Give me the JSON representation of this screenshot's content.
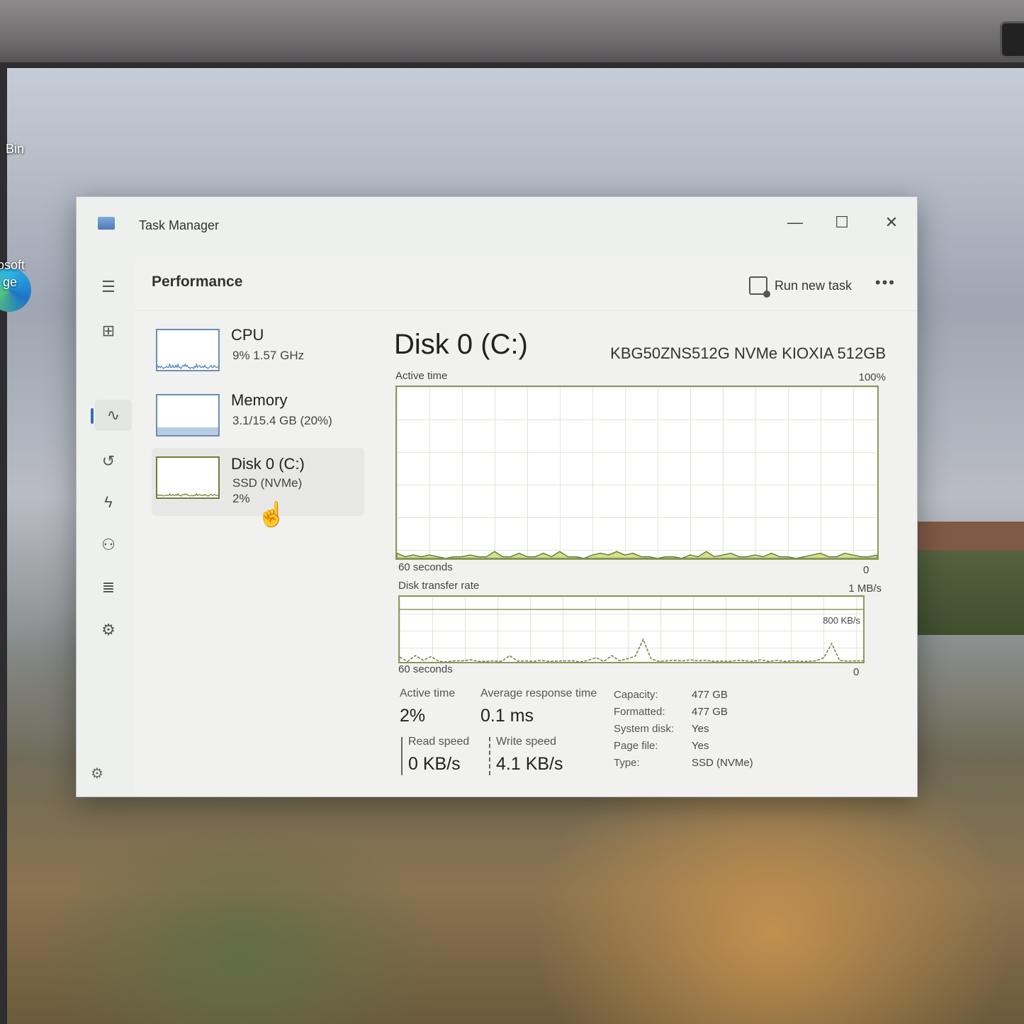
{
  "desktop": {
    "icons": [
      {
        "label": "Bin",
        "name": "recycle-bin-icon"
      },
      {
        "label": "osoft",
        "name": "edge-icon-label-line1"
      },
      {
        "label": "ge",
        "name": "edge-icon-label-line2"
      }
    ]
  },
  "window": {
    "title": "Task Manager",
    "controls": {
      "minimize": "—",
      "maximize": "☐",
      "close": "✕"
    }
  },
  "nav": [
    {
      "icon": "menu-icon",
      "glyph": "☰"
    },
    {
      "icon": "processes-icon",
      "glyph": "⊞"
    },
    {
      "icon": "performance-icon",
      "glyph": "∿",
      "active": true
    },
    {
      "icon": "app-history-icon",
      "glyph": "↺"
    },
    {
      "icon": "startup-apps-icon",
      "glyph": "ϟ"
    },
    {
      "icon": "users-icon",
      "glyph": "⚇"
    },
    {
      "icon": "details-icon",
      "glyph": "≣"
    },
    {
      "icon": "services-icon",
      "glyph": "⚙"
    }
  ],
  "header": {
    "title": "Performance",
    "run_task": "Run new task",
    "more": "•••"
  },
  "devices": [
    {
      "name": "CPU",
      "sub": "9%  1.57 GHz",
      "sub2": "",
      "usage": 0.09
    },
    {
      "name": "Memory",
      "sub": "3.1/15.4 GB (20%)",
      "sub2": "",
      "usage": 0.2
    },
    {
      "name": "Disk 0 (C:)",
      "sub": "SSD (NVMe)",
      "sub2": "2%",
      "usage": 0.02
    }
  ],
  "detail": {
    "title": "Disk 0 (C:)",
    "model": "KBG50ZNS512G NVMe KIOXIA 512GB",
    "active_chart": {
      "label": "Active time",
      "max_label": "100%",
      "x_label": "60 seconds",
      "min_label": "0"
    },
    "transfer_chart": {
      "label": "Disk transfer rate",
      "max_label": "1 MB/s",
      "mid_label": "800 KB/s",
      "x_label": "60 seconds",
      "min_label": "0"
    },
    "stats": {
      "active_label": "Active time",
      "active_value": "2%",
      "resp_label": "Average response time",
      "resp_value": "0.1 ms",
      "read_label": "Read speed",
      "read_value": "0 KB/s",
      "write_label": "Write speed",
      "write_value": "4.1 KB/s"
    },
    "properties": [
      {
        "k": "Capacity:",
        "v": "477 GB"
      },
      {
        "k": "Formatted:",
        "v": "477 GB"
      },
      {
        "k": "System disk:",
        "v": "Yes"
      },
      {
        "k": "Page file:",
        "v": "Yes"
      },
      {
        "k": "Type:",
        "v": "SSD (NVMe)"
      }
    ]
  },
  "chart_data": [
    {
      "type": "area",
      "title": "Active time",
      "ylabel": "",
      "ylim": [
        0,
        100
      ],
      "xlim": [
        60,
        0
      ],
      "x_unit": "seconds ago",
      "values": [
        3,
        1,
        2,
        1,
        2,
        1,
        0,
        1,
        1,
        2,
        1,
        1,
        4,
        1,
        1,
        3,
        1,
        1,
        3,
        1,
        4,
        1,
        1,
        0,
        2,
        3,
        2,
        4,
        2,
        3,
        1,
        1,
        0,
        1,
        1,
        0,
        2,
        1,
        4,
        1,
        2,
        3,
        1,
        1,
        2,
        1,
        3,
        1,
        1,
        0,
        1,
        2,
        3,
        1,
        1,
        3,
        2,
        1,
        1,
        2
      ]
    },
    {
      "type": "line",
      "title": "Disk transfer rate",
      "ylim": [
        0,
        1000
      ],
      "y_unit": "KB/s",
      "xlim": [
        60,
        0
      ],
      "series": [
        {
          "values": [
            90,
            10,
            120,
            30,
            100,
            10,
            0,
            20,
            20,
            40,
            10,
            10,
            20,
            10,
            120,
            15,
            20,
            10,
            30,
            10,
            15,
            20,
            20,
            0,
            30,
            80,
            10,
            120,
            20,
            60,
            110,
            430,
            60,
            10,
            20,
            30,
            20,
            40,
            20,
            30,
            10,
            15,
            10,
            30,
            20,
            10,
            40,
            10,
            30,
            10,
            20,
            10,
            10,
            20,
            80,
            350,
            30,
            15,
            20,
            20
          ]
        }
      ]
    }
  ]
}
